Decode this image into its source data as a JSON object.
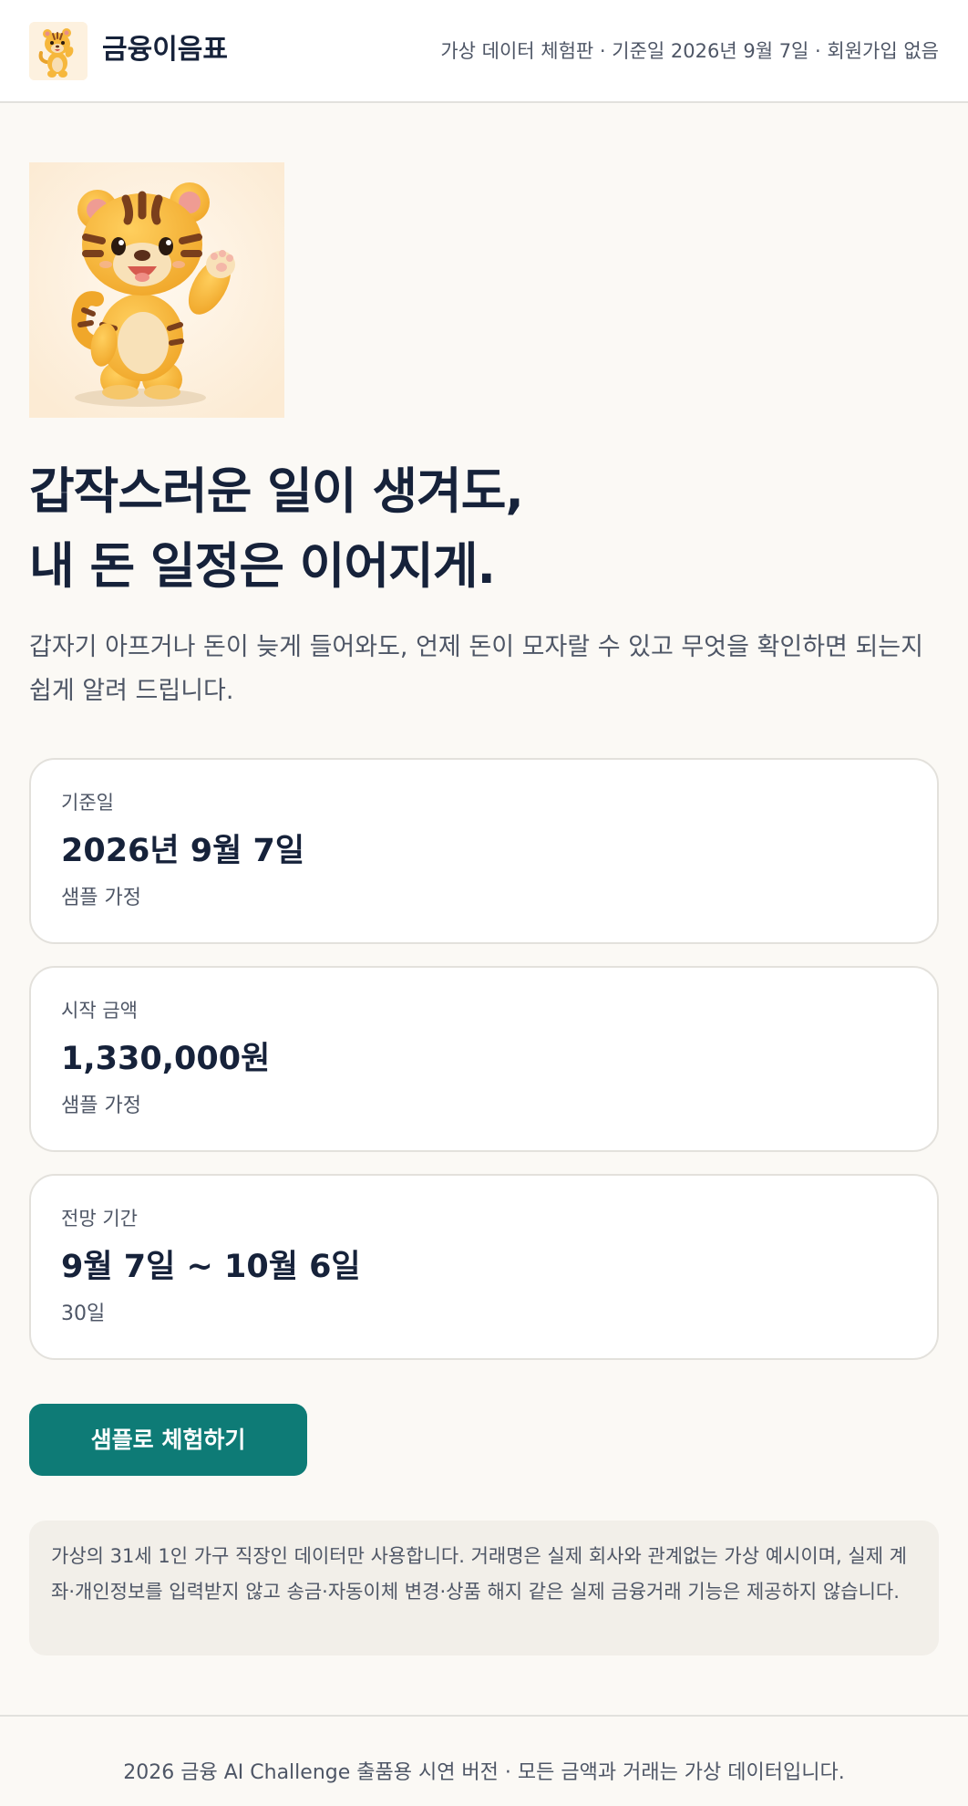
{
  "header": {
    "logo_icon": "tiger-mascot-icon",
    "brand": "금융이음표",
    "meta": "가상 데이터 체험판 · 기준일 2026년 9월 7일 · 회원가입 없음"
  },
  "hero": {
    "mascot_icon": "tiger-mascot-illustration",
    "title_line1": "갑작스러운 일이 생겨도,",
    "title_line2": "내 돈 일정은 이어지게.",
    "description": "갑자기 아프거나 돈이 늦게 들어와도, 언제 돈이 모자랄 수 있고 무엇을 확인하면 되는지 쉽게 알려 드립니다."
  },
  "cards": [
    {
      "label": "기준일",
      "value": "2026년 9월 7일",
      "note": "샘플 가정"
    },
    {
      "label": "시작 금액",
      "value": "1,330,000원",
      "note": "샘플 가정"
    },
    {
      "label": "전망 기간",
      "value": "9월 7일 ~ 10월 6일",
      "note": "30일"
    }
  ],
  "cta": {
    "label": "샘플로 체험하기"
  },
  "disclaimer": "가상의 31세 1인 가구 직장인 데이터만 사용합니다. 거래명은 실제 회사와 관계없는 가상 예시이며, 실제 계좌·개인정보를 입력받지 않고 송금·자동이체 변경·상품 해지 같은 실제 금융거래 기능은 제공하지 않습니다.",
  "footer": {
    "text": "2026 금융 AI Challenge 출품용 시연 버전 · 모든 금액과 거래는 가상 데이터입니다."
  },
  "colors": {
    "page_background": "#fbf9f5",
    "primary_text": "#16223a",
    "secondary_text": "#4e5666",
    "accent_teal": "#0e7b76",
    "card_border": "#e3e1dc",
    "disclaimer_background": "#f2efe9",
    "mascot_orange": "#f6b73c"
  }
}
